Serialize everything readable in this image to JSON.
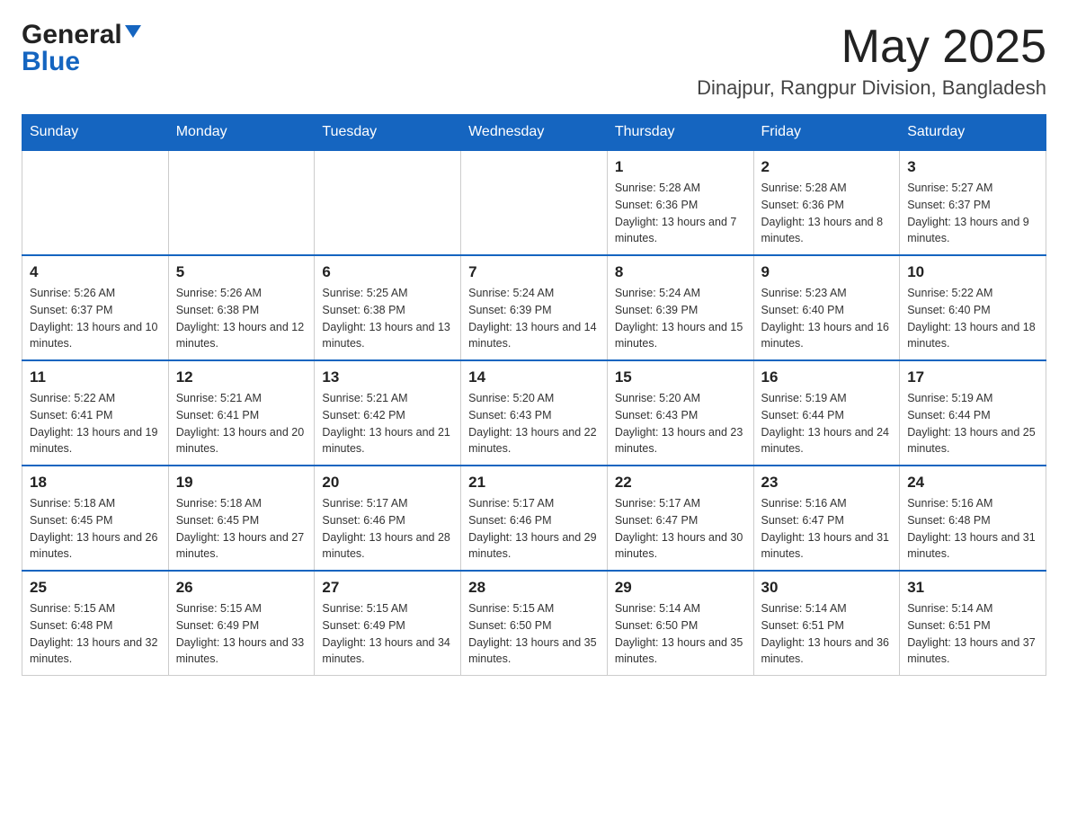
{
  "logo": {
    "general": "General",
    "blue": "Blue"
  },
  "header": {
    "month": "May 2025",
    "location": "Dinajpur, Rangpur Division, Bangladesh"
  },
  "weekdays": [
    "Sunday",
    "Monday",
    "Tuesday",
    "Wednesday",
    "Thursday",
    "Friday",
    "Saturday"
  ],
  "weeks": [
    [
      {
        "day": "",
        "sunrise": "",
        "sunset": "",
        "daylight": ""
      },
      {
        "day": "",
        "sunrise": "",
        "sunset": "",
        "daylight": ""
      },
      {
        "day": "",
        "sunrise": "",
        "sunset": "",
        "daylight": ""
      },
      {
        "day": "",
        "sunrise": "",
        "sunset": "",
        "daylight": ""
      },
      {
        "day": "1",
        "sunrise": "Sunrise: 5:28 AM",
        "sunset": "Sunset: 6:36 PM",
        "daylight": "Daylight: 13 hours and 7 minutes."
      },
      {
        "day": "2",
        "sunrise": "Sunrise: 5:28 AM",
        "sunset": "Sunset: 6:36 PM",
        "daylight": "Daylight: 13 hours and 8 minutes."
      },
      {
        "day": "3",
        "sunrise": "Sunrise: 5:27 AM",
        "sunset": "Sunset: 6:37 PM",
        "daylight": "Daylight: 13 hours and 9 minutes."
      }
    ],
    [
      {
        "day": "4",
        "sunrise": "Sunrise: 5:26 AM",
        "sunset": "Sunset: 6:37 PM",
        "daylight": "Daylight: 13 hours and 10 minutes."
      },
      {
        "day": "5",
        "sunrise": "Sunrise: 5:26 AM",
        "sunset": "Sunset: 6:38 PM",
        "daylight": "Daylight: 13 hours and 12 minutes."
      },
      {
        "day": "6",
        "sunrise": "Sunrise: 5:25 AM",
        "sunset": "Sunset: 6:38 PM",
        "daylight": "Daylight: 13 hours and 13 minutes."
      },
      {
        "day": "7",
        "sunrise": "Sunrise: 5:24 AM",
        "sunset": "Sunset: 6:39 PM",
        "daylight": "Daylight: 13 hours and 14 minutes."
      },
      {
        "day": "8",
        "sunrise": "Sunrise: 5:24 AM",
        "sunset": "Sunset: 6:39 PM",
        "daylight": "Daylight: 13 hours and 15 minutes."
      },
      {
        "day": "9",
        "sunrise": "Sunrise: 5:23 AM",
        "sunset": "Sunset: 6:40 PM",
        "daylight": "Daylight: 13 hours and 16 minutes."
      },
      {
        "day": "10",
        "sunrise": "Sunrise: 5:22 AM",
        "sunset": "Sunset: 6:40 PM",
        "daylight": "Daylight: 13 hours and 18 minutes."
      }
    ],
    [
      {
        "day": "11",
        "sunrise": "Sunrise: 5:22 AM",
        "sunset": "Sunset: 6:41 PM",
        "daylight": "Daylight: 13 hours and 19 minutes."
      },
      {
        "day": "12",
        "sunrise": "Sunrise: 5:21 AM",
        "sunset": "Sunset: 6:41 PM",
        "daylight": "Daylight: 13 hours and 20 minutes."
      },
      {
        "day": "13",
        "sunrise": "Sunrise: 5:21 AM",
        "sunset": "Sunset: 6:42 PM",
        "daylight": "Daylight: 13 hours and 21 minutes."
      },
      {
        "day": "14",
        "sunrise": "Sunrise: 5:20 AM",
        "sunset": "Sunset: 6:43 PM",
        "daylight": "Daylight: 13 hours and 22 minutes."
      },
      {
        "day": "15",
        "sunrise": "Sunrise: 5:20 AM",
        "sunset": "Sunset: 6:43 PM",
        "daylight": "Daylight: 13 hours and 23 minutes."
      },
      {
        "day": "16",
        "sunrise": "Sunrise: 5:19 AM",
        "sunset": "Sunset: 6:44 PM",
        "daylight": "Daylight: 13 hours and 24 minutes."
      },
      {
        "day": "17",
        "sunrise": "Sunrise: 5:19 AM",
        "sunset": "Sunset: 6:44 PM",
        "daylight": "Daylight: 13 hours and 25 minutes."
      }
    ],
    [
      {
        "day": "18",
        "sunrise": "Sunrise: 5:18 AM",
        "sunset": "Sunset: 6:45 PM",
        "daylight": "Daylight: 13 hours and 26 minutes."
      },
      {
        "day": "19",
        "sunrise": "Sunrise: 5:18 AM",
        "sunset": "Sunset: 6:45 PM",
        "daylight": "Daylight: 13 hours and 27 minutes."
      },
      {
        "day": "20",
        "sunrise": "Sunrise: 5:17 AM",
        "sunset": "Sunset: 6:46 PM",
        "daylight": "Daylight: 13 hours and 28 minutes."
      },
      {
        "day": "21",
        "sunrise": "Sunrise: 5:17 AM",
        "sunset": "Sunset: 6:46 PM",
        "daylight": "Daylight: 13 hours and 29 minutes."
      },
      {
        "day": "22",
        "sunrise": "Sunrise: 5:17 AM",
        "sunset": "Sunset: 6:47 PM",
        "daylight": "Daylight: 13 hours and 30 minutes."
      },
      {
        "day": "23",
        "sunrise": "Sunrise: 5:16 AM",
        "sunset": "Sunset: 6:47 PM",
        "daylight": "Daylight: 13 hours and 31 minutes."
      },
      {
        "day": "24",
        "sunrise": "Sunrise: 5:16 AM",
        "sunset": "Sunset: 6:48 PM",
        "daylight": "Daylight: 13 hours and 31 minutes."
      }
    ],
    [
      {
        "day": "25",
        "sunrise": "Sunrise: 5:15 AM",
        "sunset": "Sunset: 6:48 PM",
        "daylight": "Daylight: 13 hours and 32 minutes."
      },
      {
        "day": "26",
        "sunrise": "Sunrise: 5:15 AM",
        "sunset": "Sunset: 6:49 PM",
        "daylight": "Daylight: 13 hours and 33 minutes."
      },
      {
        "day": "27",
        "sunrise": "Sunrise: 5:15 AM",
        "sunset": "Sunset: 6:49 PM",
        "daylight": "Daylight: 13 hours and 34 minutes."
      },
      {
        "day": "28",
        "sunrise": "Sunrise: 5:15 AM",
        "sunset": "Sunset: 6:50 PM",
        "daylight": "Daylight: 13 hours and 35 minutes."
      },
      {
        "day": "29",
        "sunrise": "Sunrise: 5:14 AM",
        "sunset": "Sunset: 6:50 PM",
        "daylight": "Daylight: 13 hours and 35 minutes."
      },
      {
        "day": "30",
        "sunrise": "Sunrise: 5:14 AM",
        "sunset": "Sunset: 6:51 PM",
        "daylight": "Daylight: 13 hours and 36 minutes."
      },
      {
        "day": "31",
        "sunrise": "Sunrise: 5:14 AM",
        "sunset": "Sunset: 6:51 PM",
        "daylight": "Daylight: 13 hours and 37 minutes."
      }
    ]
  ]
}
